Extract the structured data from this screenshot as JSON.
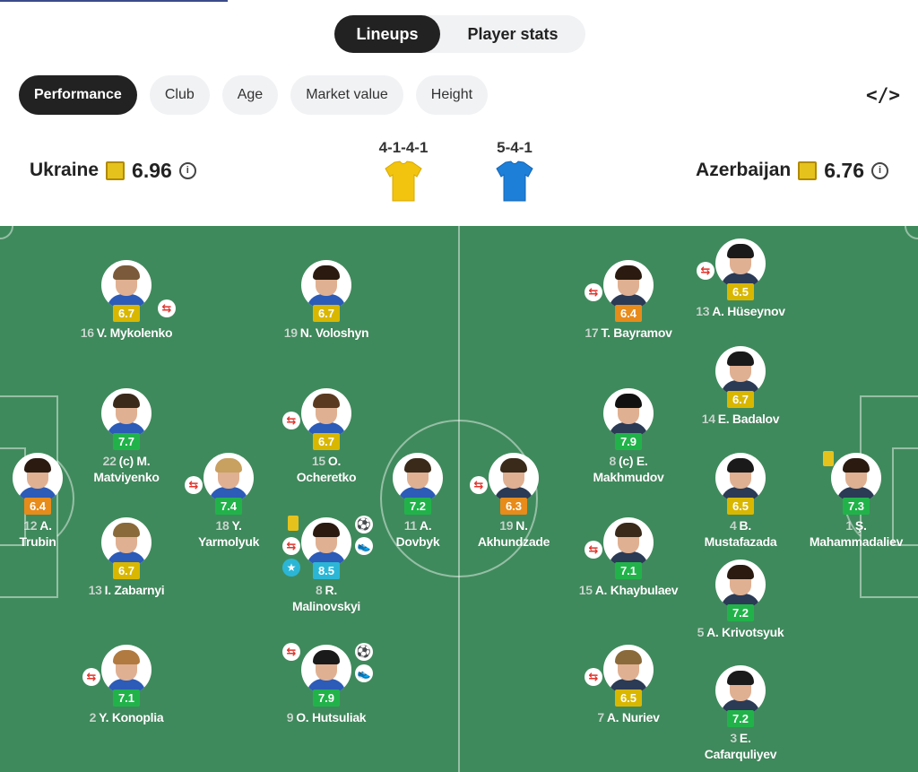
{
  "tabs": {
    "lineups": "Lineups",
    "player_stats": "Player stats"
  },
  "chips": [
    "Performance",
    "Club",
    "Age",
    "Market value",
    "Height"
  ],
  "embed_icon": "</>",
  "home": {
    "name": "Ukraine",
    "rating": "6.96",
    "formation": "4-1-4-1",
    "jersey_color": "#f2c40f"
  },
  "away": {
    "name": "Azerbaijan",
    "rating": "6.76",
    "formation": "5-4-1",
    "jersey_color": "#1e7fd8"
  },
  "colors": {
    "pitch": "#3f8a5c",
    "rating_green": "#21b34a",
    "rating_yellow": "#d9b700",
    "rating_orange": "#e78b1b",
    "rating_blue": "#2bb6d6"
  },
  "players": [
    {
      "num": "16",
      "name": "V. Mykolenko",
      "line2": "",
      "rating": "6.7",
      "tone": "yellow",
      "events": [
        "sub"
      ]
    },
    {
      "num": "19",
      "name": "N. Voloshyn",
      "line2": "",
      "rating": "6.7",
      "tone": "yellow",
      "events": []
    },
    {
      "num": "22",
      "name": "(c) M.",
      "line2": "Matviyenko",
      "rating": "7.7",
      "tone": "green",
      "events": []
    },
    {
      "num": "15",
      "name": "O.",
      "line2": "Ocheretko",
      "rating": "6.7",
      "tone": "yellow",
      "events": [
        "sub"
      ]
    },
    {
      "num": "12",
      "name": "A.",
      "line2": "Trubin",
      "rating": "6.4",
      "tone": "orange",
      "events": []
    },
    {
      "num": "18",
      "name": "Y.",
      "line2": "Yarmolyuk",
      "rating": "7.4",
      "tone": "green",
      "events": [
        "sub"
      ]
    },
    {
      "num": "11",
      "name": "A.",
      "line2": "Dovbyk",
      "rating": "7.2",
      "tone": "green",
      "events": []
    },
    {
      "num": "13",
      "name": "I. Zabarnyi",
      "line2": "",
      "rating": "6.7",
      "tone": "yellow",
      "events": []
    },
    {
      "num": "8",
      "name": "R.",
      "line2": "Malinovskyi",
      "rating": "8.5",
      "tone": "blue",
      "events": [
        "card",
        "sub",
        "star",
        "goal",
        "assist"
      ]
    },
    {
      "num": "2",
      "name": "Y. Konoplia",
      "line2": "",
      "rating": "7.1",
      "tone": "green",
      "events": [
        "sub"
      ]
    },
    {
      "num": "9",
      "name": "O. Hutsuliak",
      "line2": "",
      "rating": "7.9",
      "tone": "green",
      "events": [
        "sub",
        "goal",
        "assist"
      ]
    },
    {
      "num": "17",
      "name": "T. Bayramov",
      "line2": "",
      "rating": "6.4",
      "tone": "orange",
      "events": [
        "sub"
      ]
    },
    {
      "num": "13",
      "name": "A. Hüseynov",
      "line2": "",
      "rating": "6.5",
      "tone": "yellow",
      "events": [
        "sub"
      ]
    },
    {
      "num": "14",
      "name": "E. Badalov",
      "line2": "",
      "rating": "6.7",
      "tone": "yellow",
      "events": []
    },
    {
      "num": "8",
      "name": "(c) E.",
      "line2": "Makhmudov",
      "rating": "7.9",
      "tone": "green",
      "events": []
    },
    {
      "num": "19",
      "name": "N.",
      "line2": "Akhundzade",
      "rating": "6.3",
      "tone": "orange",
      "events": [
        "sub"
      ]
    },
    {
      "num": "4",
      "name": "B.",
      "line2": "Mustafazada",
      "rating": "6.5",
      "tone": "yellow",
      "events": []
    },
    {
      "num": "1",
      "name": "Ş.",
      "line2": "Mahammadaliev",
      "rating": "7.3",
      "tone": "green",
      "events": [
        "card"
      ]
    },
    {
      "num": "15",
      "name": "A. Khaybulaev",
      "line2": "",
      "rating": "7.1",
      "tone": "green",
      "events": [
        "sub"
      ]
    },
    {
      "num": "5",
      "name": "A. Krivotsyuk",
      "line2": "",
      "rating": "7.2",
      "tone": "green",
      "events": []
    },
    {
      "num": "7",
      "name": "A. Nuriev",
      "line2": "",
      "rating": "6.5",
      "tone": "yellow",
      "events": [
        "sub"
      ]
    },
    {
      "num": "3",
      "name": "E.",
      "line2": "Cafarquliyev",
      "rating": "7.2",
      "tone": "green",
      "events": []
    }
  ]
}
